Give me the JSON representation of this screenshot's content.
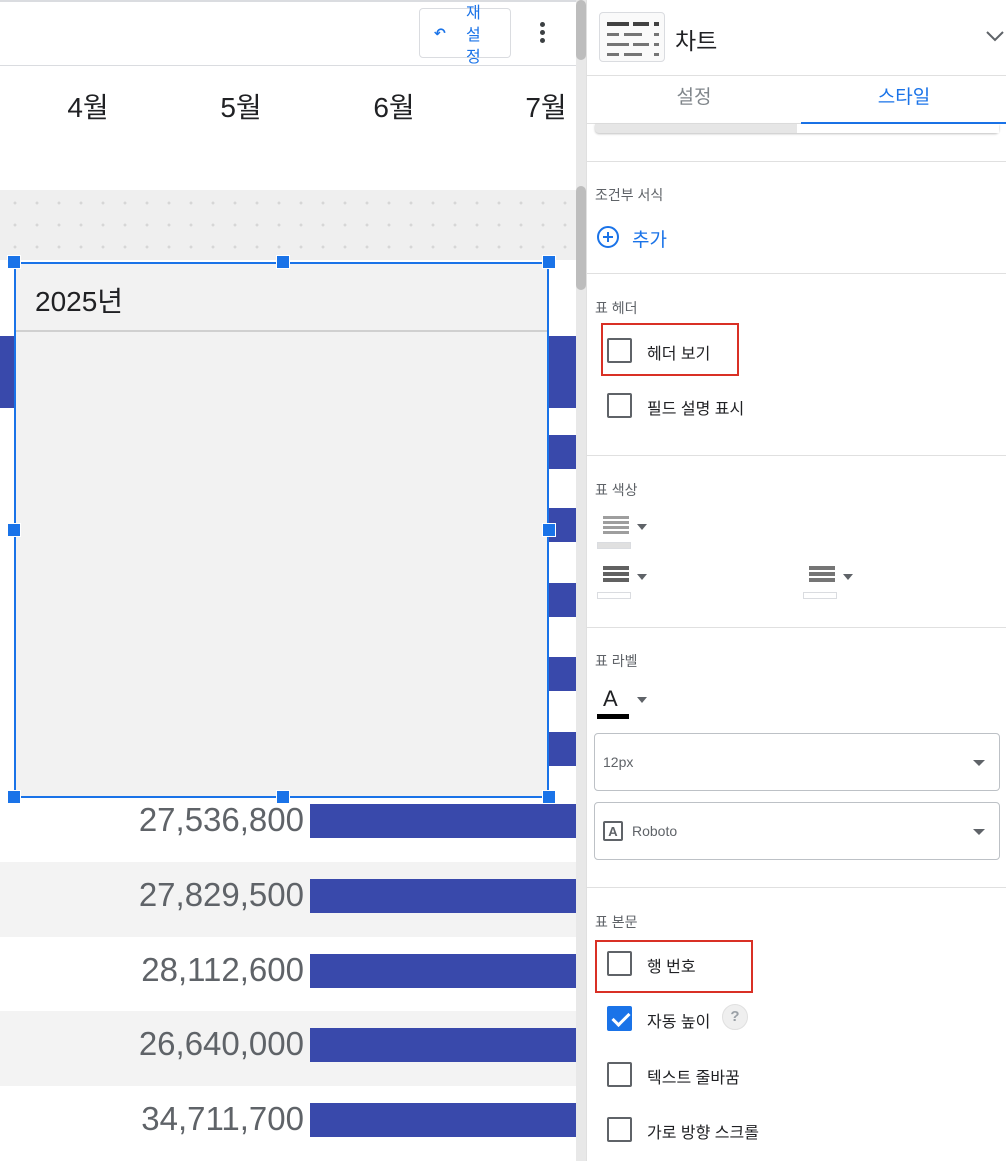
{
  "toolbar": {
    "reset_label": "재설정",
    "undo_icon": "undo-icon",
    "more_icon": "more-vert-icon"
  },
  "chart": {
    "months": [
      "4월",
      "5월",
      "6월",
      "7월"
    ],
    "selected_header": "2025년",
    "bar_color": "#3949ab",
    "rows": [
      {
        "value": "27,536,800"
      },
      {
        "value": "27,829,500"
      },
      {
        "value": "28,112,600"
      },
      {
        "value": "26,640,000"
      },
      {
        "value": "34,711,700"
      }
    ]
  },
  "panel": {
    "title": "차트",
    "tabs": {
      "setup": "설정",
      "style": "스타일"
    },
    "conditional": {
      "title": "조건부 서식",
      "add_label": "추가"
    },
    "header_section": {
      "title": "표 헤더",
      "show_header": {
        "label": "헤더 보기",
        "checked": false
      },
      "show_field_desc": {
        "label": "필드 설명 표시",
        "checked": false
      }
    },
    "colors_section": {
      "title": "표 색상"
    },
    "labels_section": {
      "title": "표 라벨",
      "font_size": "12px",
      "font_family": "Roboto"
    },
    "body_section": {
      "title": "표 본문",
      "row_numbers": {
        "label": "행 번호",
        "checked": false
      },
      "auto_height": {
        "label": "자동 높이",
        "checked": true
      },
      "wrap_text": {
        "label": "텍스트 줄바꿈",
        "checked": false
      },
      "horizontal_scroll": {
        "label": "가로 방향 스크롤",
        "checked": false
      },
      "help_glyph": "?"
    },
    "accent_color": "#1a73e8",
    "highlight_color": "#d93025"
  }
}
